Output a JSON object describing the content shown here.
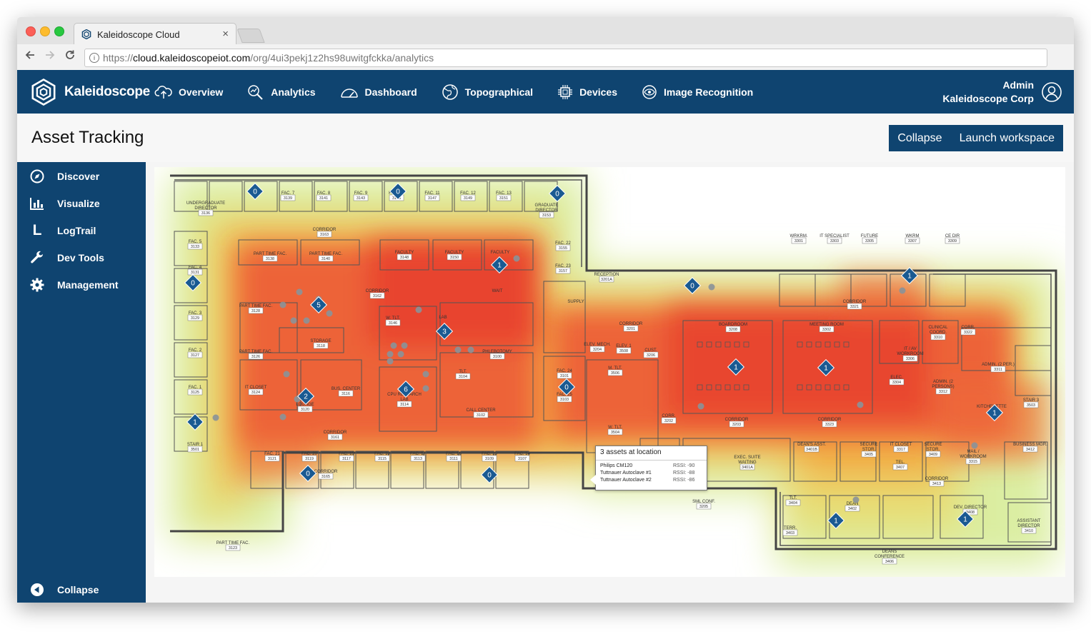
{
  "browser": {
    "tab_title": "Kaleidoscope Cloud",
    "tab_close": "×",
    "url_scheme": "https://",
    "url_host": "cloud.kaleidoscopeiot.com",
    "url_path": "/org/4ui3pekj1z2hs98uwitgfckka/analytics"
  },
  "appnav": {
    "brand": "Kaleidoscope",
    "items": [
      {
        "label": "Overview",
        "icon": "cloud-upload-icon"
      },
      {
        "label": "Analytics",
        "icon": "analytics-magnifier-icon"
      },
      {
        "label": "Dashboard",
        "icon": "gauge-icon"
      },
      {
        "label": "Topographical",
        "icon": "globe-icon"
      },
      {
        "label": "Devices",
        "icon": "chip-icon"
      },
      {
        "label": "Image Recognition",
        "icon": "eye-icon"
      }
    ],
    "user_role": "Admin",
    "user_org": "Kaleidoscope Corp"
  },
  "header": {
    "title": "Asset Tracking",
    "collapse_label": "Collapse",
    "launch_label": "Launch workspace"
  },
  "sidebar": {
    "items": [
      {
        "label": "Discover",
        "icon": "compass-icon"
      },
      {
        "label": "Visualize",
        "icon": "bar-chart-icon"
      },
      {
        "label": "LogTrail",
        "icon": "logtrail-icon"
      },
      {
        "label": "Dev Tools",
        "icon": "wrench-icon"
      },
      {
        "label": "Management",
        "icon": "gear-icon"
      }
    ],
    "collapse_label": "Collapse",
    "collapse_glyph": "◀",
    "logtrail_glyph": "L"
  },
  "map": {
    "rooms": [
      {
        "label": "UNDERGRADUATE\nDIRECTOR",
        "num": "3136"
      },
      {
        "label": "FAC. 7",
        "num": "3139"
      },
      {
        "label": "FAC. 8",
        "num": "3141"
      },
      {
        "label": "FAC. 9",
        "num": "3143"
      },
      {
        "label": "FAC. 10",
        "num": "3145"
      },
      {
        "label": "FAC. 11",
        "num": "3147"
      },
      {
        "label": "FAC. 12",
        "num": "3149"
      },
      {
        "label": "FAC. 13",
        "num": "3151"
      },
      {
        "label": "GRADUATE\nDIRECTOR",
        "num": "3153"
      },
      {
        "label": "CORRIDOR",
        "num": "3163"
      },
      {
        "label": "FAC. 5",
        "num": "3133"
      },
      {
        "label": "FAC. 4",
        "num": "3131"
      },
      {
        "label": "FAC. 3",
        "num": "3129"
      },
      {
        "label": "FAC. 2",
        "num": "3127"
      },
      {
        "label": "FAC. 1",
        "num": "3125"
      },
      {
        "label": "PART TIME FAC.",
        "num": "3138"
      },
      {
        "label": "PART TIME FAC.",
        "num": "3140"
      },
      {
        "label": "FACULTY",
        "num": "3148"
      },
      {
        "label": "FACULTY",
        "num": "3150"
      },
      {
        "label": "FACULTY",
        "num": ""
      },
      {
        "label": "FAC. 22",
        "num": "3155"
      },
      {
        "label": "FAC. 23",
        "num": "3157"
      },
      {
        "label": "PART TIME FAC.",
        "num": "3128"
      },
      {
        "label": "PART TIME FAC.",
        "num": "3126"
      },
      {
        "label": "STORAGE",
        "num": "3118"
      },
      {
        "label": "CORRIDOR",
        "num": "3162"
      },
      {
        "label": "W. TLT.",
        "num": "3146"
      },
      {
        "label": "LAB",
        "num": ""
      },
      {
        "label": "PHLEBOTOMY",
        "num": "3100"
      },
      {
        "label": "TLT.",
        "num": "3104"
      },
      {
        "label": "IT CLOSET",
        "num": "3124"
      },
      {
        "label": "LOUNGE",
        "num": "3120"
      },
      {
        "label": "BUS. CENTER",
        "num": "3116"
      },
      {
        "label": "CPU RESEARCH\nLAB",
        "num": "3114"
      },
      {
        "label": "CALL CENTER",
        "num": "3102"
      },
      {
        "label": "CORRIDOR",
        "num": "3161"
      },
      {
        "label": "STAIR 1",
        "num": "3501"
      },
      {
        "label": "FAC. 21",
        "num": "3121"
      },
      {
        "label": "FAC. 20",
        "num": "3119"
      },
      {
        "label": "FAC. 19",
        "num": "3117"
      },
      {
        "label": "FAC. 18",
        "num": "3115"
      },
      {
        "label": "FAC. 17",
        "num": "3113"
      },
      {
        "label": "FAC. 16",
        "num": "3111"
      },
      {
        "label": "FAC. 15",
        "num": "3109"
      },
      {
        "label": "FAC. 14",
        "num": "3107"
      },
      {
        "label": "PART TIME FAC.",
        "num": "3123"
      },
      {
        "label": "CORRIDOR",
        "num": "3165"
      },
      {
        "label": "WAIT",
        "num": ""
      },
      {
        "label": "SUPPLY",
        "num": ""
      },
      {
        "label": "RECEPTION",
        "num": "3201A"
      },
      {
        "label": "ELEV. MECH.",
        "num": "3204"
      },
      {
        "label": "ELEV. 1",
        "num": "3508"
      },
      {
        "label": "CUST.",
        "num": "3206"
      },
      {
        "label": "FAC. 24",
        "num": "3101"
      },
      {
        "label": "FAC. 25",
        "num": "3103"
      },
      {
        "label": "M. TLT.",
        "num": "3506"
      },
      {
        "label": "W. TLT.",
        "num": "3504"
      },
      {
        "label": "WRK. STUDY",
        "num": "3105"
      },
      {
        "label": "CORR.",
        "num": "3202"
      },
      {
        "label": "CORRIDOR",
        "num": "3201"
      },
      {
        "label": "BOARDROOM",
        "num": "3208"
      },
      {
        "label": "MEETING ROOM",
        "num": "3302"
      },
      {
        "label": "CORRIDOR",
        "num": "3203"
      },
      {
        "label": "CORRIDOR",
        "num": "3323"
      },
      {
        "label": "EXEC. SUITE\nWAITING",
        "num": "3401A"
      },
      {
        "label": "SML CONF.",
        "num": "3205"
      },
      {
        "label": "DEAN'S ASST.",
        "num": "3401B"
      },
      {
        "label": "WRKRM.",
        "num": "3301"
      },
      {
        "label": "IT SPECIALIST",
        "num": "3303"
      },
      {
        "label": "FUTURE",
        "num": "3305"
      },
      {
        "label": "WKRM",
        "num": "3307"
      },
      {
        "label": "CE DIR",
        "num": "3309"
      },
      {
        "label": "CORRIDOR",
        "num": "3321"
      },
      {
        "label": "CLINICAL\nCOORD.",
        "num": "3310"
      },
      {
        "label": "CORR.",
        "num": "3322"
      },
      {
        "label": "IT / AV\nWORKROOM",
        "num": "3306"
      },
      {
        "label": "ELEC.",
        "num": "3304"
      },
      {
        "label": "ADMIN. (2\nPERSONS)",
        "num": "3312"
      },
      {
        "label": "ADMIN. (2 PER.)",
        "num": "3311"
      },
      {
        "label": "STAIR 3",
        "num": "3503"
      },
      {
        "label": "KITCHENETTE",
        "num": ""
      },
      {
        "label": "SECURE\nSTOR.",
        "num": "3405"
      },
      {
        "label": "IT CLOSET",
        "num": "3317"
      },
      {
        "label": "TEL.",
        "num": "3407"
      },
      {
        "label": "SECURE\nSTOR.",
        "num": "3409"
      },
      {
        "label": "MAIL /\nWORKROOM",
        "num": "3315"
      },
      {
        "label": "BUSINESS MGR.",
        "num": "3412"
      },
      {
        "label": "CORRIDOR",
        "num": "3413"
      },
      {
        "label": "TLT.",
        "num": "3404"
      },
      {
        "label": "DEAN",
        "num": "3402"
      },
      {
        "label": "TERR.",
        "num": "3403"
      },
      {
        "label": "DEV. DIRECTOR",
        "num": "3408"
      },
      {
        "label": "ASSISTANT\nDIRECTOR",
        "num": "3410"
      },
      {
        "label": "DEANS\nCONFERENCE",
        "num": "3406"
      }
    ],
    "markers": [
      "0",
      "0",
      "0",
      "0",
      "1",
      "0",
      "5",
      "2",
      "1",
      "6",
      "3",
      "0",
      "0",
      "0",
      "1",
      "1",
      "1",
      "1",
      "1",
      "1",
      "0"
    ],
    "tooltip": {
      "title": "3 assets at location",
      "items": [
        {
          "name": "Philips CM120",
          "rssi": "RSSI: -90"
        },
        {
          "name": "Tuttnauer Autoclave #1",
          "rssi": "RSSI: -88"
        },
        {
          "name": "Tuttnauer Autoclave #2",
          "rssi": "RSSI: -86"
        }
      ]
    }
  }
}
